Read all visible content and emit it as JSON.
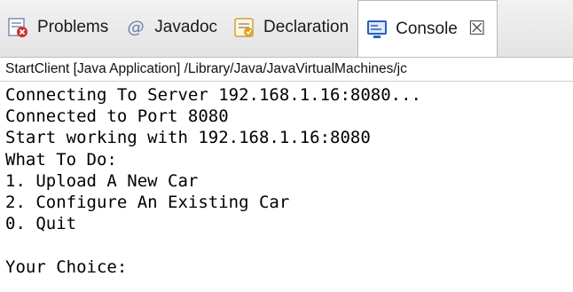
{
  "tabs": [
    {
      "label": "Problems",
      "icon": "problems-icon"
    },
    {
      "label": "Javadoc",
      "icon": "javadoc-icon"
    },
    {
      "label": "Declaration",
      "icon": "declaration-icon"
    },
    {
      "label": "Console",
      "icon": "console-icon",
      "active": true,
      "closable": true
    }
  ],
  "console": {
    "process_label": "StartClient [Java Application] /Library/Java/JavaVirtualMachines/jc",
    "lines": [
      "Connecting To Server 192.168.1.16:8080...",
      "Connected to Port 8080",
      "Start working with 192.168.1.16:8080",
      "What To Do:",
      "1. Upload A New Car",
      "2. Configure An Existing Car",
      "0. Quit",
      "",
      "Your Choice:"
    ]
  },
  "colors": {
    "tabbar_bg": "#e8e8e8",
    "problems_icon": "#cc3333",
    "declaration_icon": "#e0a020",
    "console_icon": "#2d5fb8"
  }
}
